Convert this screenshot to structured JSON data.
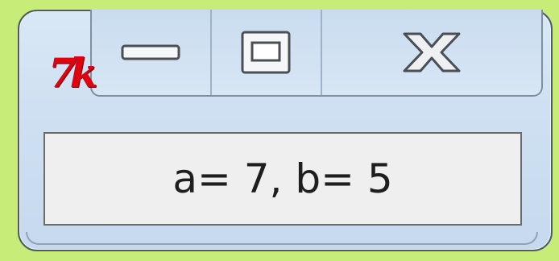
{
  "window": {
    "app_icon_text": "7k",
    "caption_buttons": {
      "minimize_icon": "minimize-icon",
      "maximize_icon": "maximize-icon",
      "close_icon": "close-icon"
    },
    "label_text": "a= 7, b= 5"
  },
  "colors": {
    "background": "#c8ec78",
    "window_frame": "#cfe0f2",
    "icon_red": "#e00010",
    "label_bg": "#efefef"
  }
}
